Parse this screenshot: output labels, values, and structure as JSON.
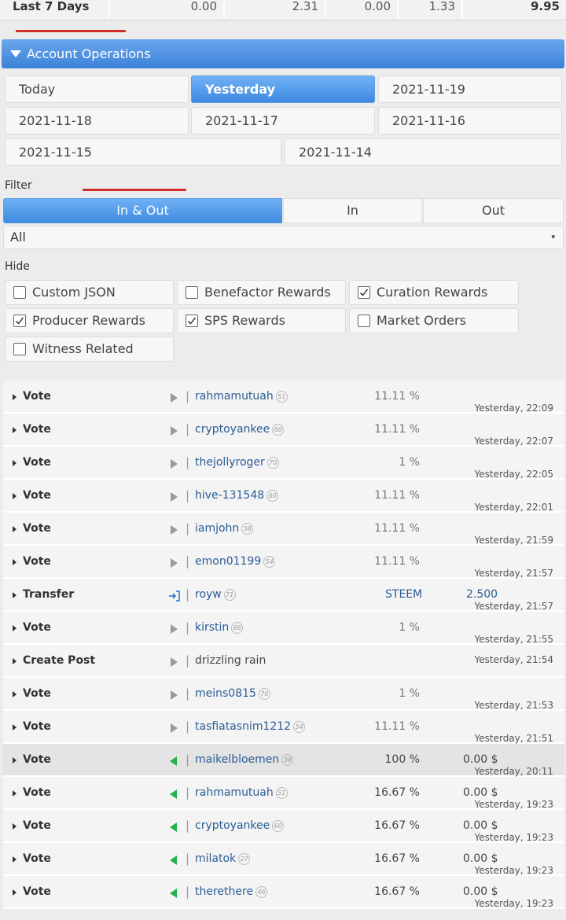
{
  "summary": {
    "label": "Last 7 Days",
    "values": [
      "0.00",
      "2.31",
      "0.00",
      "1.33",
      "9.95"
    ]
  },
  "account_operations": {
    "title": "Account Operations"
  },
  "dates": [
    "Today",
    "Yesterday",
    "2021-11-19",
    "2021-11-18",
    "2021-11-17",
    "2021-11-16",
    "2021-11-15",
    "2021-11-14"
  ],
  "active_date": "Yesterday",
  "filter": {
    "label": "Filter",
    "segments": [
      "In & Out",
      "In",
      "Out"
    ],
    "active": "In & Out",
    "select_value": "All",
    "select_arrow": "▾"
  },
  "hide": {
    "label": "Hide",
    "options": [
      {
        "label": "Custom JSON",
        "checked": false
      },
      {
        "label": "Benefactor Rewards",
        "checked": false
      },
      {
        "label": "Curation Rewards",
        "checked": true
      },
      {
        "label": "Producer Rewards",
        "checked": true
      },
      {
        "label": "SPS Rewards",
        "checked": true
      },
      {
        "label": "Market Orders",
        "checked": false
      },
      {
        "label": "Witness Related",
        "checked": false
      }
    ]
  },
  "operations": [
    {
      "type": "Vote",
      "icon": "play-gray-icon",
      "who": "rahmamutuah",
      "rep": "51",
      "pct": "11.11 %",
      "amount": "",
      "time": "Yesterday, 22:09"
    },
    {
      "type": "Vote",
      "icon": "play-gray-icon",
      "who": "cryptoyankee",
      "rep": "60",
      "pct": "11.11 %",
      "amount": "",
      "time": "Yesterday, 22:07"
    },
    {
      "type": "Vote",
      "icon": "play-gray-icon",
      "who": "thejollyroger",
      "rep": "70",
      "pct": "1 %",
      "amount": "",
      "time": "Yesterday, 22:05"
    },
    {
      "type": "Vote",
      "icon": "play-gray-icon",
      "who": "hive-131548",
      "rep": "60",
      "pct": "11.11 %",
      "amount": "",
      "time": "Yesterday, 22:01"
    },
    {
      "type": "Vote",
      "icon": "play-gray-icon",
      "who": "iamjohn",
      "rep": "58",
      "pct": "11.11 %",
      "amount": "",
      "time": "Yesterday, 21:59"
    },
    {
      "type": "Vote",
      "icon": "play-gray-icon",
      "who": "emon01199",
      "rep": "54",
      "pct": "11.11 %",
      "amount": "",
      "time": "Yesterday, 21:57"
    },
    {
      "type": "Transfer",
      "icon": "transfer-in-icon",
      "who": "royw",
      "rep": "71",
      "coin": "STEEM",
      "pct": "",
      "amount": "2.500",
      "time": "Yesterday, 21:57"
    },
    {
      "type": "Vote",
      "icon": "play-gray-icon",
      "who": "kirstin",
      "rep": "66",
      "pct": "1 %",
      "amount": "",
      "time": "Yesterday, 21:55"
    },
    {
      "type": "Create Post",
      "icon": "play-gray-icon",
      "who": "drizzling rain",
      "rep": "",
      "pct": "",
      "amount": "",
      "time": "Yesterday, 21:54"
    },
    {
      "type": "Vote",
      "icon": "play-gray-icon",
      "who": "meins0815",
      "rep": "70",
      "pct": "1 %",
      "amount": "",
      "time": "Yesterday, 21:53"
    },
    {
      "type": "Vote",
      "icon": "play-gray-icon",
      "who": "tasfiatasnim1212",
      "rep": "54",
      "pct": "11.11 %",
      "amount": "",
      "time": "Yesterday, 21:51"
    },
    {
      "type": "Vote",
      "icon": "play-green-left-icon",
      "who": "maikelbloemen",
      "rep": "39",
      "pct": "100 %",
      "amount": "0.00 $",
      "time": "Yesterday, 20:11"
    },
    {
      "type": "Vote",
      "icon": "play-green-left-icon",
      "who": "rahmamutuah",
      "rep": "51",
      "pct": "16.67 %",
      "amount": "0.00 $",
      "time": "Yesterday, 19:23"
    },
    {
      "type": "Vote",
      "icon": "play-green-left-icon",
      "who": "cryptoyankee",
      "rep": "60",
      "pct": "16.67 %",
      "amount": "0.00 $",
      "time": "Yesterday, 19:23"
    },
    {
      "type": "Vote",
      "icon": "play-green-left-icon",
      "who": "milatok",
      "rep": "27",
      "pct": "16.67 %",
      "amount": "0.00 $",
      "time": "Yesterday, 19:23"
    },
    {
      "type": "Vote",
      "icon": "play-green-left-icon",
      "who": "therethere",
      "rep": "46",
      "pct": "16.67 %",
      "amount": "0.00 $",
      "time": "Yesterday, 19:23"
    }
  ],
  "colors": {
    "accent": "#3d8ae0",
    "highlight": "#d42b2b",
    "green": "#22b24c",
    "link": "#2a5c94"
  }
}
